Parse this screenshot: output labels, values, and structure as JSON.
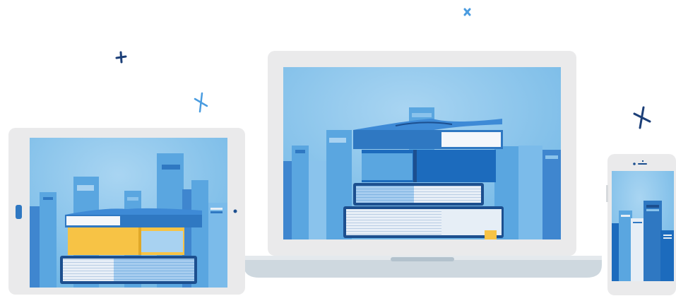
{
  "illustration": {
    "devices": [
      "tablet",
      "laptop",
      "phone"
    ],
    "subject": "book-stack",
    "sparkles": 4
  },
  "colors": {
    "device_frame": "#eaeaeb",
    "device_bezel": "#f4f4f5",
    "laptop_base": "#ced8df",
    "screen_sky_light": "#9ccdee",
    "screen_sky": "#6fb7e6",
    "book_dark": "#1c4f8f",
    "book_mid": "#2f78c2",
    "book_light": "#5aa6e0",
    "pages": "#e6eef6",
    "book_yellow": "#f7c345",
    "bookmark": "#f7c345",
    "sparkle_dark": "#1c3f78",
    "sparkle_light": "#4a9ce0"
  }
}
